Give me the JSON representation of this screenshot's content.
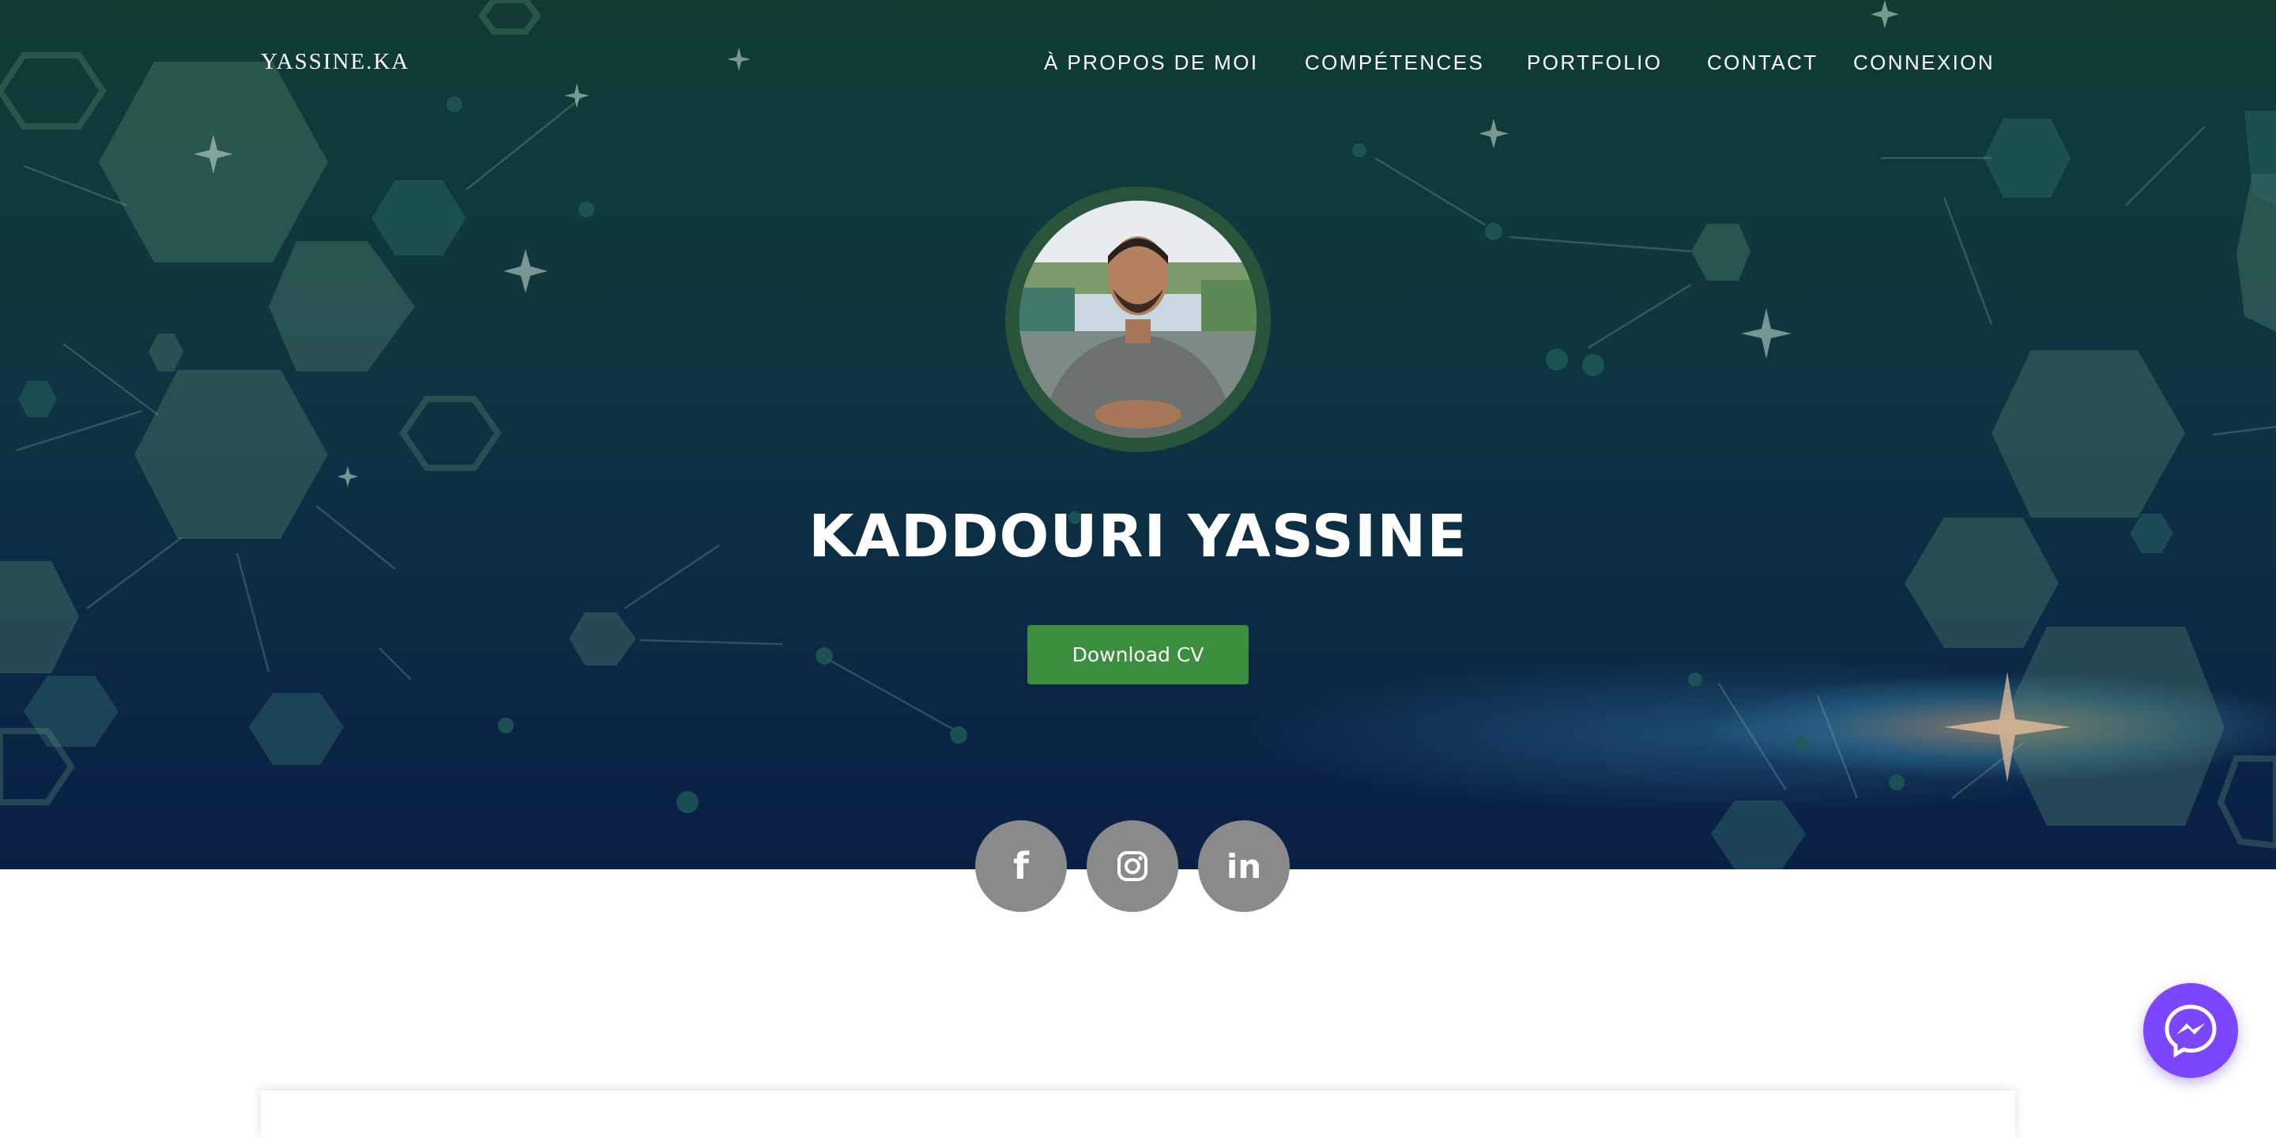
{
  "brand": "YASSINE.KA",
  "nav": {
    "items": [
      {
        "label": "À PROPOS DE MOI"
      },
      {
        "label": "COMPÉTENCES"
      },
      {
        "label": "PORTFOLIO"
      },
      {
        "label": "CONTACT"
      },
      {
        "label": "CONNEXION"
      }
    ]
  },
  "hero": {
    "name": "KADDOURI YASSINE",
    "cv_button": "Download CV"
  },
  "social": [
    {
      "icon": "facebook-icon",
      "glyph": "f"
    },
    {
      "icon": "instagram-icon"
    },
    {
      "icon": "linkedin-icon",
      "glyph": "in"
    }
  ],
  "colors": {
    "accent_green": "#3a8e3d",
    "avatar_ring": "#27543b",
    "social_gray": "#8a8a8a",
    "messenger": "#7c45ff"
  }
}
